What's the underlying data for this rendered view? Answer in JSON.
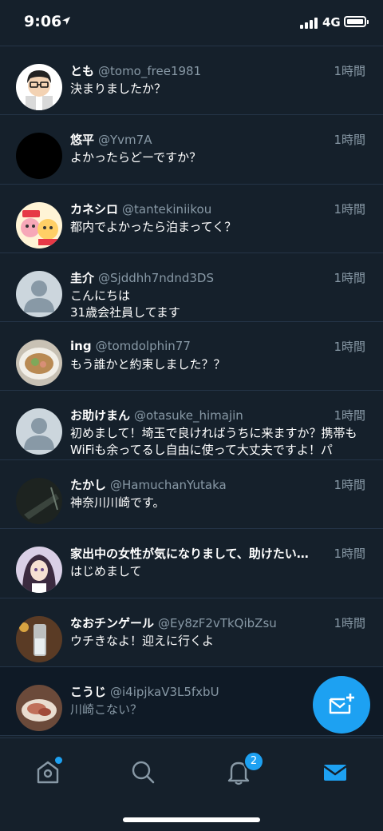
{
  "status_bar": {
    "time": "9:06",
    "network": "4G"
  },
  "conversations": [
    {
      "name": "とも",
      "handle": "@tomo_free1981",
      "time": "1時間",
      "message": "決まりましたか？",
      "avatar": "cartoon-man"
    },
    {
      "name": "悠平",
      "handle": "@Yvm7A",
      "time": "1時間",
      "message": "よかったらどーですか？",
      "avatar": "black"
    },
    {
      "name": "カネシロ",
      "handle": "@tantekiniikou",
      "time": "1時間",
      "message": "都内でよかったら泊まってく？",
      "avatar": "illustration"
    },
    {
      "name": "圭介",
      "handle": "@Sjddhh7ndnd3DS",
      "time": "1時間",
      "message": "こんにちは\n31歳会社員してます",
      "avatar": "default"
    },
    {
      "name": "ing",
      "handle": "@tomdolphin77",
      "time": "1時間",
      "message": "もう誰かと約束しました？？",
      "avatar": "ramen"
    },
    {
      "name": "お助けまん",
      "handle": "@otasuke_himajin",
      "time": "1時間",
      "message": "初めまして！埼玉で良ければうちに来ますか？携帯もWiFiも余ってるし自由に使って大丈夫ですよ！パ",
      "avatar": "default"
    },
    {
      "name": "たかし",
      "handle": "@HamuchanYutaka",
      "time": "1時間",
      "message": "神奈川川崎です。",
      "avatar": "dark-photo"
    },
    {
      "name": "家出中の女性が気になりまして、助けたい…",
      "handle": "",
      "time": "1時間",
      "message": "はじめまして",
      "avatar": "anime-girl"
    },
    {
      "name": "なおチンゲール",
      "handle": "@Ey8zF2vTkQibZsu",
      "time": "1時間",
      "message": "ウチきなよ！迎えに行くよ",
      "avatar": "glass"
    },
    {
      "name": "こうじ",
      "handle": "@i4ipjkaV3L5fxbU",
      "time": "",
      "message": "川崎こない？",
      "avatar": "food"
    }
  ],
  "compose_button": {
    "icon": "new-message-icon"
  },
  "tab_bar": {
    "tabs": [
      "home-icon",
      "search-icon",
      "notifications-icon",
      "messages-icon"
    ],
    "notification_count": "2",
    "accent": "#1da1f2"
  }
}
